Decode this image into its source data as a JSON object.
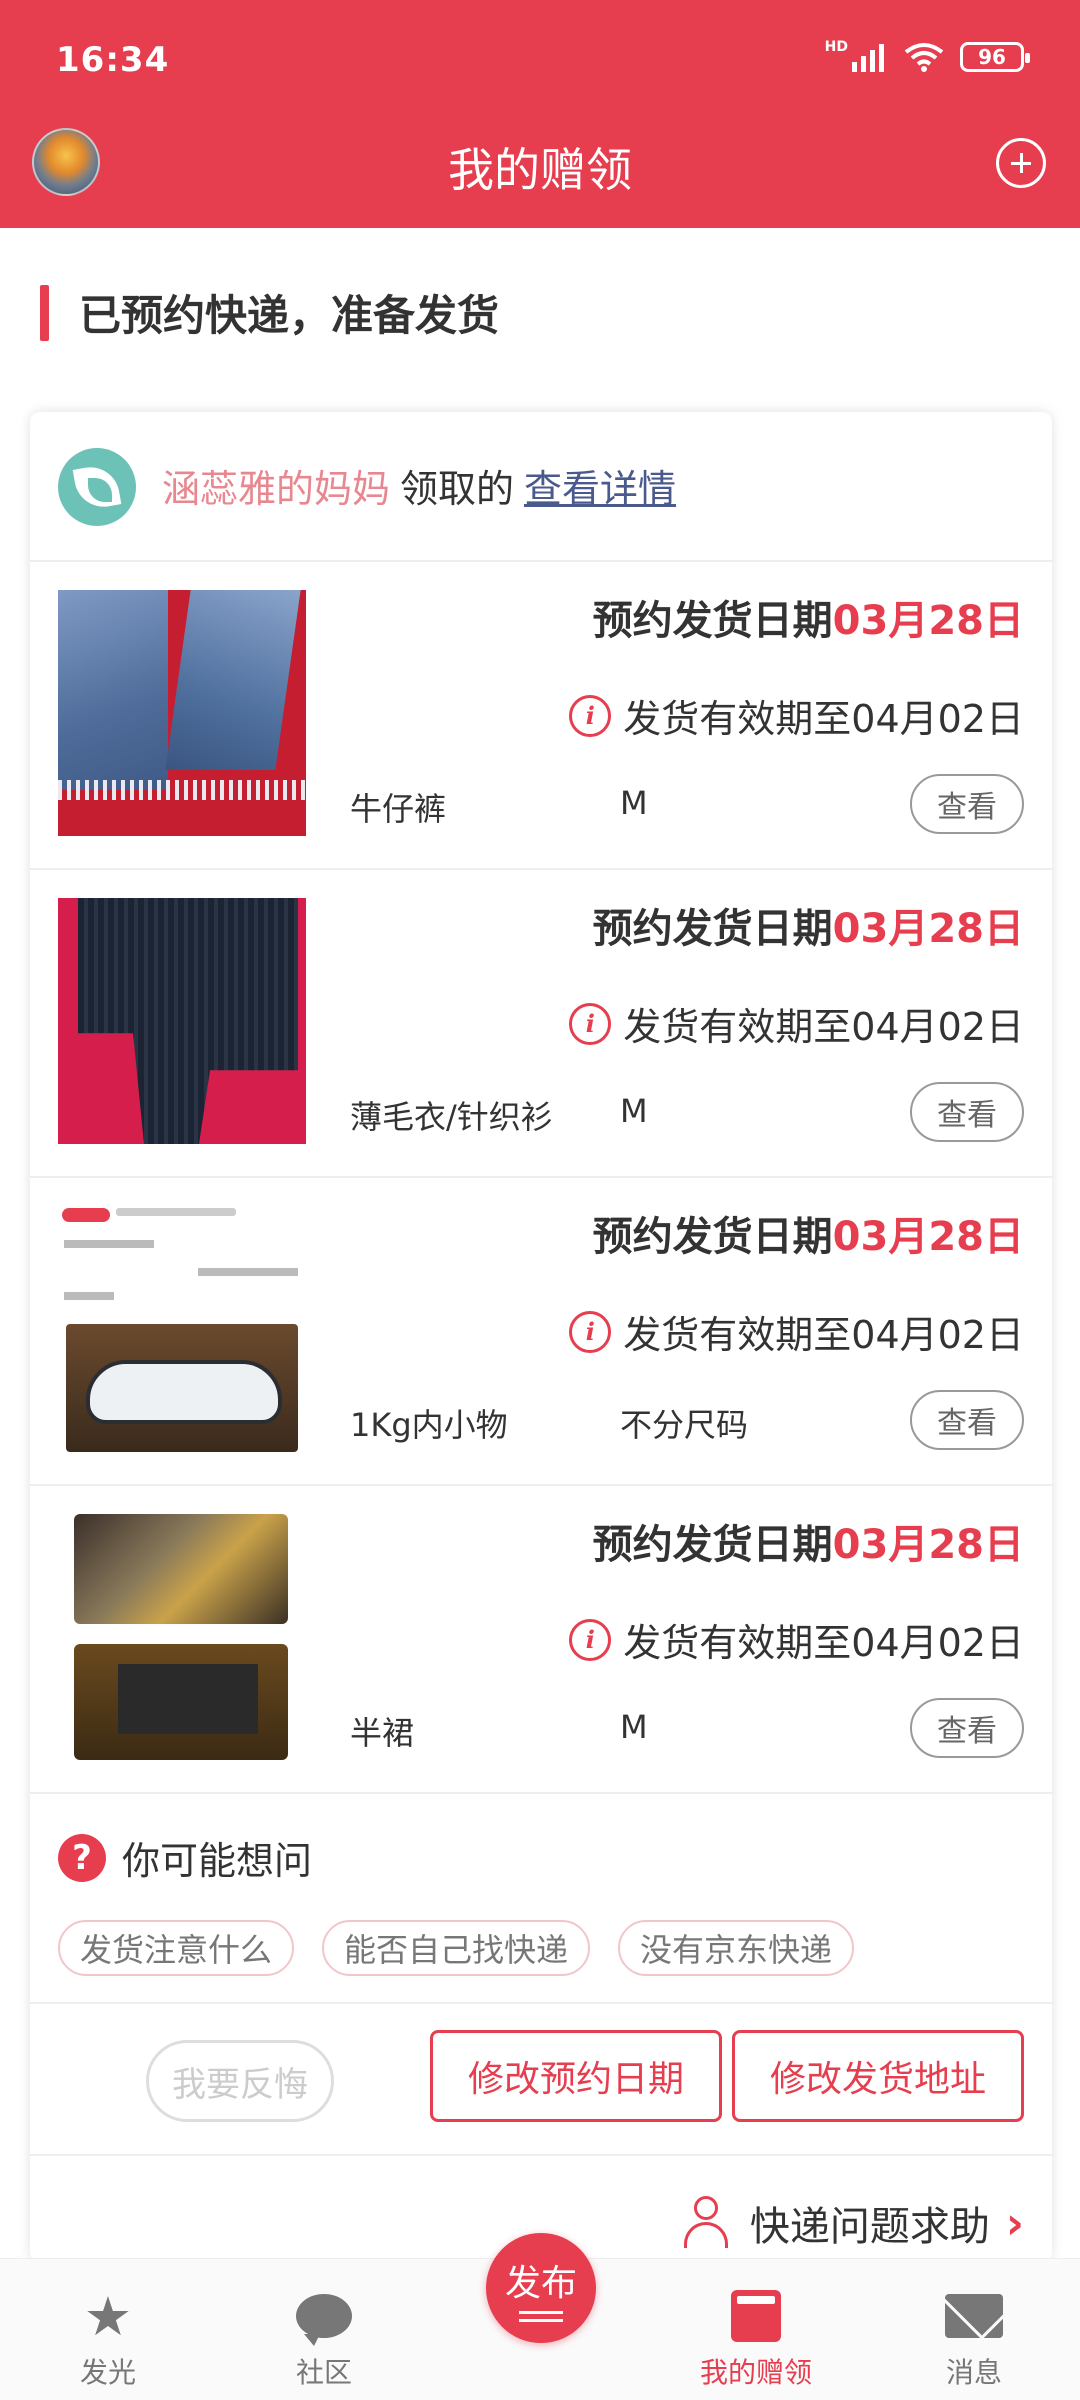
{
  "status_bar": {
    "time": "16:34",
    "network": "HD",
    "battery": "96"
  },
  "header": {
    "title": "我的赠领"
  },
  "section": {
    "title": "已预约快递，准备发货"
  },
  "receiver": {
    "name": "涵蕊雅的妈妈",
    "action": "领取的",
    "detail_link": "查看详情"
  },
  "items": [
    {
      "schedule_label": "预约发货日期",
      "schedule_date": "03月28日",
      "expiry": "发货有效期至04月02日",
      "name": "牛仔裤",
      "size": "M",
      "view": "查看",
      "thumb": "jeans-photo"
    },
    {
      "schedule_label": "预约发货日期",
      "schedule_date": "03月28日",
      "expiry": "发货有效期至04月02日",
      "name": "薄毛衣/针织衫",
      "size": "M",
      "view": "查看",
      "thumb": "sweater-photo"
    },
    {
      "schedule_label": "预约发货日期",
      "schedule_date": "03月28日",
      "expiry": "发货有效期至04月02日",
      "name": "1Kg内小物",
      "size": "不分尺码",
      "view": "查看",
      "thumb": "massager-photo"
    },
    {
      "schedule_label": "预约发货日期",
      "schedule_date": "03月28日",
      "expiry": "发货有效期至04月02日",
      "name": "半裙",
      "size": "M",
      "view": "查看",
      "thumb": "skirt-photo"
    }
  ],
  "faq": {
    "title": "你可能想问",
    "tags": [
      "发货注意什么",
      "能否自己找快递",
      "没有京东快递"
    ]
  },
  "actions": {
    "regret": "我要反悔",
    "change_date": "修改预约日期",
    "change_address": "修改发货地址"
  },
  "help": {
    "label": "快递问题求助"
  },
  "tabbar": {
    "home": "发光",
    "community": "社区",
    "publish": "发布",
    "mine": "我的赠领",
    "messages": "消息"
  },
  "colors": {
    "accent": "#e63e4f",
    "link": "#4a5a8c",
    "receiver_name": "#e8878f"
  }
}
